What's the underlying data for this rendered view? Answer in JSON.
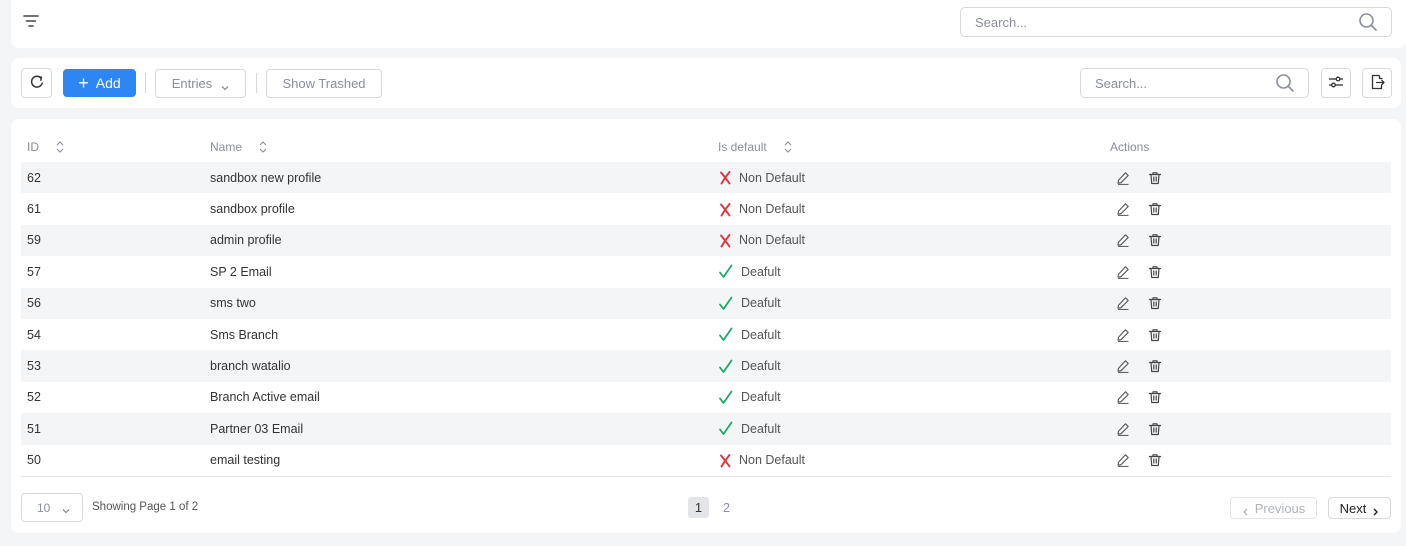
{
  "topbar": {
    "search_placeholder": "Search..."
  },
  "toolbar": {
    "add_label": "Add",
    "entries_label": "Entries",
    "show_trashed_label": "Show Trashed",
    "search_placeholder": "Search..."
  },
  "table": {
    "columns": {
      "id": "ID",
      "name": "Name",
      "is_default": "Is default",
      "actions": "Actions"
    },
    "rows": [
      {
        "id": "62",
        "name": "sandbox new profile",
        "status": "Non Default",
        "is_default": false
      },
      {
        "id": "61",
        "name": "sandbox profile",
        "status": "Non Default",
        "is_default": false
      },
      {
        "id": "59",
        "name": "admin profile",
        "status": "Non Default",
        "is_default": false
      },
      {
        "id": "57",
        "name": "SP 2 Email",
        "status": "Deafult",
        "is_default": true
      },
      {
        "id": "56",
        "name": "sms two",
        "status": "Deafult",
        "is_default": true
      },
      {
        "id": "54",
        "name": "Sms Branch",
        "status": "Deafult",
        "is_default": true
      },
      {
        "id": "53",
        "name": "branch watalio",
        "status": "Deafult",
        "is_default": true
      },
      {
        "id": "52",
        "name": "Branch Active email",
        "status": "Deafult",
        "is_default": true
      },
      {
        "id": "51",
        "name": "Partner 03 Email",
        "status": "Deafult",
        "is_default": true
      },
      {
        "id": "50",
        "name": "email testing",
        "status": "Non Default",
        "is_default": false
      }
    ]
  },
  "pagination": {
    "page_size": "10",
    "showing_text": "Showing Page 1 of 2",
    "pages": [
      "1",
      "2"
    ],
    "current_page": "1",
    "previous_label": "Previous",
    "next_label": "Next"
  },
  "icons": {
    "filter": "filter-menu-icon",
    "search": "search-icon",
    "refresh": "refresh-icon",
    "plus": "plus-icon",
    "columns": "sliders-icon",
    "export": "export-file-icon",
    "edit": "pencil-icon",
    "delete": "trash-icon",
    "default_yes": "check-icon",
    "default_no": "cross-icon"
  },
  "colors": {
    "primary": "#2e86f5",
    "check_green": "#1aa86b",
    "cross_red": "#e2323b",
    "stripe": "#f4f5f7"
  }
}
